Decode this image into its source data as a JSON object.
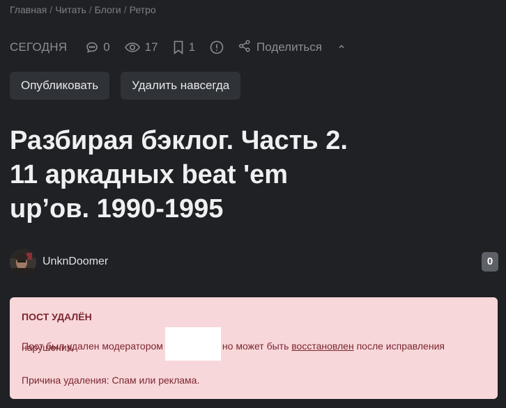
{
  "breadcrumb": {
    "items": [
      "Главная",
      "Читать",
      "Блоги",
      "Ретро"
    ],
    "separator": "/"
  },
  "meta": {
    "date": "СЕГОДНЯ",
    "comments": "0",
    "views": "17",
    "bookmarks": "1",
    "share_label": "Поделиться"
  },
  "actions": {
    "publish_label": "Опубликовать",
    "delete_label": "Удалить навсегда"
  },
  "post": {
    "title": "Разбирая бэклог. Часть 2. 11 аркадных beat 'em up’ов. 1990-1995"
  },
  "author": {
    "name": "UnknDoomer",
    "count": "0"
  },
  "notice": {
    "heading": "ПОСТ УДАЛЁН",
    "text_before": "Пост был удален модератором",
    "text_middle": "но может быть",
    "restore_link": "восстановлен",
    "text_after": "после исправления",
    "text_line2": "нарушения.",
    "reason": "Причина удаления: Спам или реклама."
  },
  "colors": {
    "background": "#1f2124",
    "button_bg": "#2f3237",
    "notice_bg": "#f8d7da",
    "notice_text": "#7a2630",
    "badge_bg": "#5d6167"
  },
  "icons": [
    "comment-icon",
    "eye-icon",
    "bookmark-icon",
    "alert-icon",
    "share-icon",
    "chevron-up-icon"
  ]
}
